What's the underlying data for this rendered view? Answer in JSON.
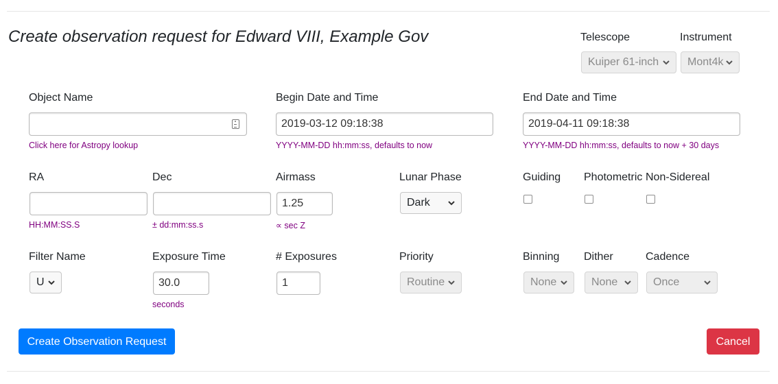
{
  "header": {
    "title": "Create observation request for Edward VIII, Example Gov",
    "telescope_label": "Telescope",
    "telescope_value": "Kuiper 61-inch",
    "instrument_label": "Instrument",
    "instrument_value": "Mont4k"
  },
  "row1": {
    "object_name_label": "Object Name",
    "object_name_value": "",
    "object_name_help": "Click here for Astropy lookup",
    "begin_label": "Begin Date and Time",
    "begin_value": "2019-03-12 09:18:38",
    "begin_help": "YYYY-MM-DD hh:mm:ss, defaults to now",
    "end_label": "End Date and Time",
    "end_value": "2019-04-11 09:18:38",
    "end_help": "YYYY-MM-DD hh:mm:ss, defaults to now + 30 days"
  },
  "row2": {
    "ra_label": "RA",
    "ra_value": "",
    "ra_help": "HH:MM:SS.S",
    "dec_label": "Dec",
    "dec_value": "",
    "dec_help": "± dd:mm:ss.s",
    "airmass_label": "Airmass",
    "airmass_value": "1.25",
    "airmass_help": "∝ sec Z",
    "lunar_label": "Lunar Phase",
    "lunar_value": "Dark",
    "guiding_label": "Guiding",
    "photometric_label": "Photometric",
    "nonsidereal_label": "Non-Sidereal"
  },
  "row3": {
    "filter_label": "Filter Name",
    "filter_value": "U",
    "exposure_label": "Exposure Time",
    "exposure_value": "30.0",
    "exposure_help": "seconds",
    "num_exposures_label": "# Exposures",
    "num_exposures_value": "1",
    "priority_label": "Priority",
    "priority_value": "Routine",
    "binning_label": "Binning",
    "binning_value": "None",
    "dither_label": "Dither",
    "dither_value": "None",
    "cadence_label": "Cadence",
    "cadence_value": "Once"
  },
  "actions": {
    "create_label": "Create Observation Request",
    "cancel_label": "Cancel"
  },
  "colors": {
    "primary": "#007bff",
    "danger": "#dc3545",
    "help_text": "#800080"
  }
}
